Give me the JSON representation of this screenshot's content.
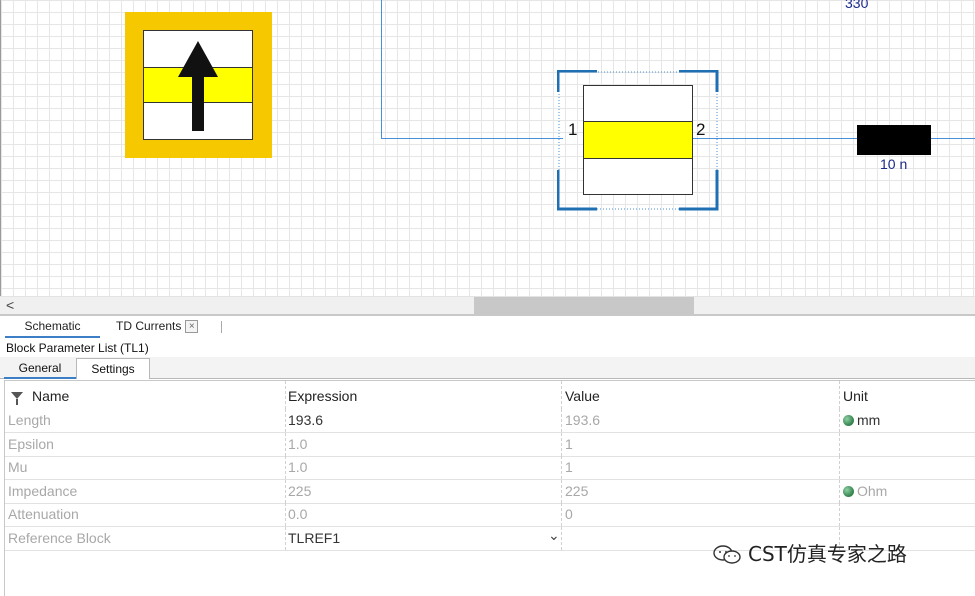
{
  "canvas": {
    "resistor_value_label": "330",
    "inductor_value_label": "10 n",
    "port_label_1": "1",
    "port_label_2": "2"
  },
  "doc_tabs": {
    "schematic": "Schematic",
    "td_currents": "TD Currents",
    "close_glyph": "×"
  },
  "panel": {
    "title": "Block Parameter List (TL1)",
    "tabs": {
      "general": "General",
      "settings": "Settings"
    }
  },
  "table": {
    "headers": {
      "name": "Name",
      "expression": "Expression",
      "value": "Value",
      "unit": "Unit"
    },
    "rows": [
      {
        "name": "Length",
        "expression": "193.6",
        "value": "193.6",
        "unit": "mm"
      },
      {
        "name": "Epsilon",
        "expression": "1.0",
        "value": "1",
        "unit": ""
      },
      {
        "name": "Mu",
        "expression": "1.0",
        "value": "1",
        "unit": ""
      },
      {
        "name": "Impedance",
        "expression": "225",
        "value": "225",
        "unit": "Ohm"
      },
      {
        "name": "Attenuation",
        "expression": "0.0",
        "value": "0",
        "unit": ""
      },
      {
        "name": "Reference Block",
        "expression": "TLREF1",
        "value": "",
        "unit": ""
      }
    ]
  },
  "scroll_left_glyph": "<",
  "dropdown_glyph": "⌄",
  "watermark": "CST仿真专家之路",
  "colors": {
    "block_yellow": "#ffff00",
    "frame_gold": "#f5c800",
    "selection_blue": "#1f6fb3",
    "wire_blue": "#4a90d9",
    "label_navy": "#1a2a8a"
  }
}
